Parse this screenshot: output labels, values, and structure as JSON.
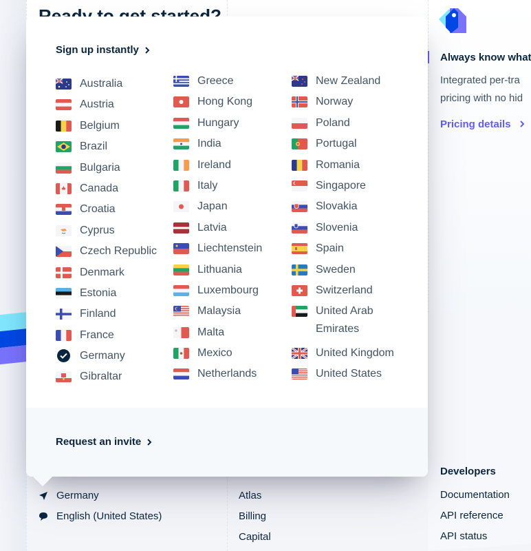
{
  "background": {
    "heading": "Ready to get started?",
    "pricing_card": {
      "icon": "price-tag-icon",
      "title": "Always know what",
      "text_lines": [
        "Integrated per-tra",
        "pricing with no hid"
      ],
      "link": "Pricing details"
    },
    "footer": {
      "locale": {
        "country": "Germany",
        "language": "English (United States)"
      },
      "products": [
        "Atlas",
        "Billing",
        "Capital"
      ],
      "developers": {
        "heading": "Developers",
        "links": [
          "Documentation",
          "API reference",
          "API status"
        ]
      }
    },
    "colors": {
      "accent": "#635bff",
      "navy": "#0a2540",
      "text": "#425466"
    }
  },
  "popover": {
    "sign_up_label": "Sign up instantly",
    "request_invite_label": "Request an invite",
    "selected_country": "Germany",
    "columns": [
      [
        {
          "name": "Australia",
          "flag": "au"
        },
        {
          "name": "Austria",
          "flag": "at"
        },
        {
          "name": "Belgium",
          "flag": "be"
        },
        {
          "name": "Brazil",
          "flag": "br"
        },
        {
          "name": "Bulgaria",
          "flag": "bg"
        },
        {
          "name": "Canada",
          "flag": "ca"
        },
        {
          "name": "Croatia",
          "flag": "hr"
        },
        {
          "name": "Cyprus",
          "flag": "cy"
        },
        {
          "name": "Czech Republic",
          "flag": "cz"
        },
        {
          "name": "Denmark",
          "flag": "dk"
        },
        {
          "name": "Estonia",
          "flag": "ee"
        },
        {
          "name": "Finland",
          "flag": "fi"
        },
        {
          "name": "France",
          "flag": "fr"
        },
        {
          "name": "Germany",
          "flag": "check"
        },
        {
          "name": "Gibraltar",
          "flag": "gi"
        }
      ],
      [
        {
          "name": "Greece",
          "flag": "gr"
        },
        {
          "name": "Hong Kong",
          "flag": "hk"
        },
        {
          "name": "Hungary",
          "flag": "hu"
        },
        {
          "name": "India",
          "flag": "in"
        },
        {
          "name": "Ireland",
          "flag": "ie"
        },
        {
          "name": "Italy",
          "flag": "it"
        },
        {
          "name": "Japan",
          "flag": "jp"
        },
        {
          "name": "Latvia",
          "flag": "lv"
        },
        {
          "name": "Liechtenstein",
          "flag": "li"
        },
        {
          "name": "Lithuania",
          "flag": "lt"
        },
        {
          "name": "Luxembourg",
          "flag": "lu"
        },
        {
          "name": "Malaysia",
          "flag": "my"
        },
        {
          "name": "Malta",
          "flag": "mt"
        },
        {
          "name": "Mexico",
          "flag": "mx"
        },
        {
          "name": "Netherlands",
          "flag": "nl"
        }
      ],
      [
        {
          "name": "New Zealand",
          "flag": "nz"
        },
        {
          "name": "Norway",
          "flag": "no"
        },
        {
          "name": "Poland",
          "flag": "pl"
        },
        {
          "name": "Portugal",
          "flag": "pt"
        },
        {
          "name": "Romania",
          "flag": "ro"
        },
        {
          "name": "Singapore",
          "flag": "sg"
        },
        {
          "name": "Slovakia",
          "flag": "sk"
        },
        {
          "name": "Slovenia",
          "flag": "si"
        },
        {
          "name": "Spain",
          "flag": "es"
        },
        {
          "name": "Sweden",
          "flag": "se"
        },
        {
          "name": "Switzerland",
          "flag": "ch"
        },
        {
          "name": "United Arab Emirates",
          "flag": "ae"
        },
        {
          "name": "United Kingdom",
          "flag": "gb"
        },
        {
          "name": "United States",
          "flag": "us"
        }
      ]
    ]
  }
}
